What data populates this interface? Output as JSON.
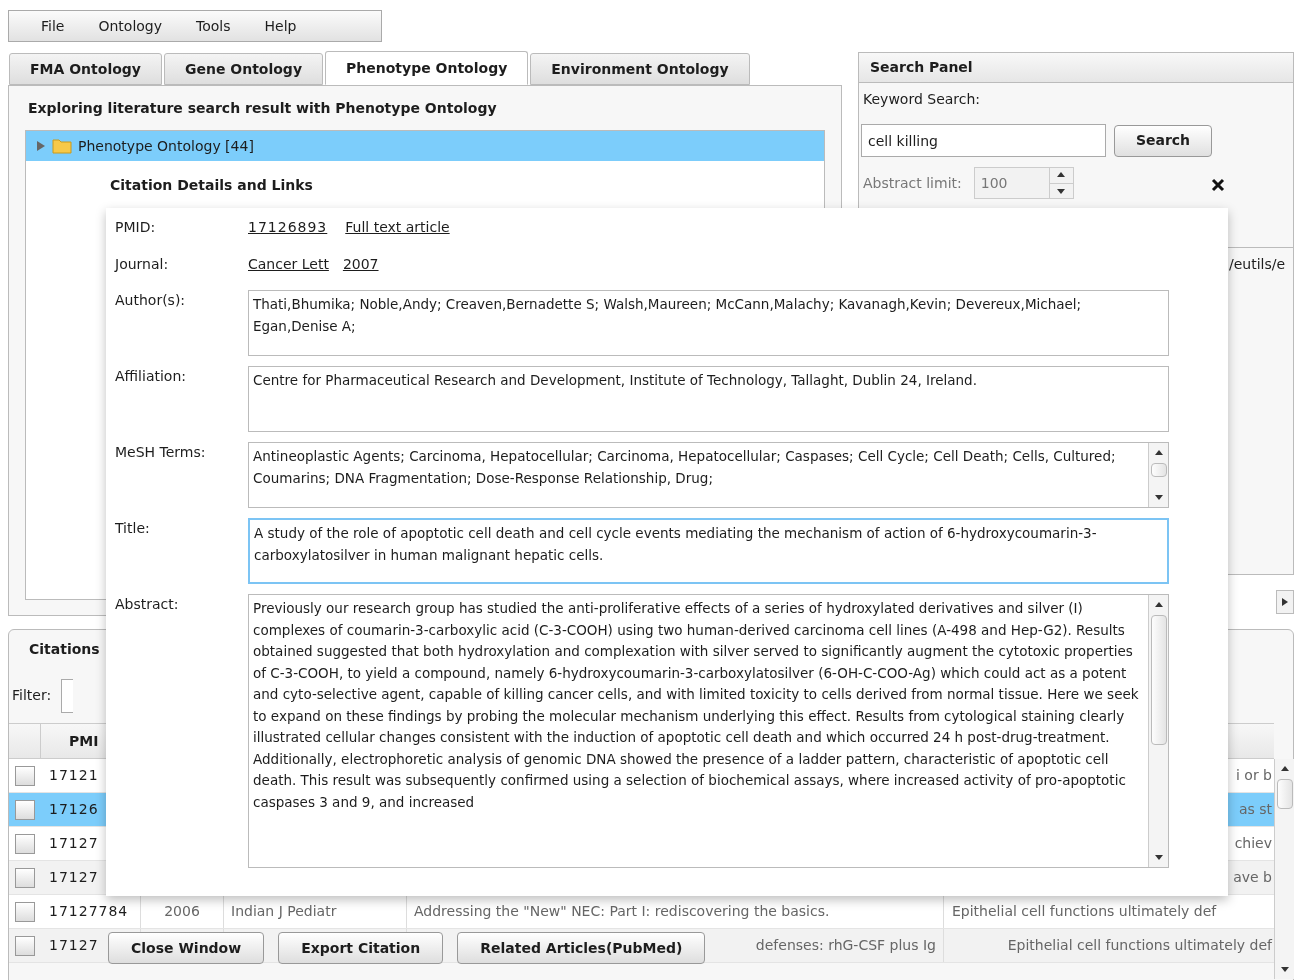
{
  "menu": [
    "File",
    "Ontology",
    "Tools",
    "Help"
  ],
  "tabs": [
    {
      "label": "FMA Ontology",
      "selected": false
    },
    {
      "label": "Gene Ontology",
      "selected": false
    },
    {
      "label": "Phenotype Ontology",
      "selected": true
    },
    {
      "label": "Environment Ontology",
      "selected": false
    }
  ],
  "ontology_panel": {
    "title": "Exploring literature search result with Phenotype Ontology",
    "tree": [
      {
        "label": "Phenotype Ontology [44]",
        "expanded": false,
        "selected": true
      }
    ]
  },
  "search_panel": {
    "title": "Search Panel",
    "keyword_label": "Keyword Search:",
    "keyword_value": "cell killing",
    "search_button": "Search",
    "abstract_limit_label": "Abstract limit:",
    "abstract_limit_value": "100",
    "url_fragment": "/eutils/e"
  },
  "citations": {
    "title": "Citations",
    "filter_label": "Filter:",
    "columns": [
      "PMI"
    ],
    "rows": [
      {
        "kind": "partial",
        "checked": false,
        "selected": false,
        "pmid": "17121",
        "abstract": "i or b"
      },
      {
        "kind": "partial",
        "checked": false,
        "selected": true,
        "pmid": "17126",
        "abstract": "as st"
      },
      {
        "kind": "partial",
        "checked": false,
        "selected": false,
        "pmid": "17127",
        "abstract": "chiev"
      },
      {
        "kind": "partial",
        "checked": false,
        "selected": false,
        "pmid": "17127",
        "abstract": "ave b"
      },
      {
        "kind": "full",
        "checked": false,
        "selected": false,
        "pmid": "17127784",
        "year": "2006",
        "journal": "Indian J Pediatr",
        "title": "Addressing the \"New\" NEC: Part I: rediscovering the basics.",
        "abstract": "Epithelial cell functions ultimately def"
      },
      {
        "kind": "partial",
        "checked": false,
        "selected": false,
        "pmid": "17127",
        "title": "defenses: rhG-CSF plus Ig",
        "abstract": "Epithelial cell functions ultimately def"
      }
    ]
  },
  "dialog": {
    "title": "Citation Details and Links",
    "pmid_label": "PMID:",
    "pmid": "17126893",
    "full_text_link": "Full text article",
    "journal_label": "Journal:",
    "journal": "Cancer Lett",
    "year": "2007",
    "fields": [
      {
        "kind": "box",
        "label": "Author(s):",
        "value": "Thati,Bhumika; Noble,Andy; Creaven,Bernadette S; Walsh,Maureen; McCann,Malachy; Kavanagh,Kevin; Devereux,Michael; Egan,Denise A;",
        "focused": false
      },
      {
        "kind": "box",
        "label": "Affiliation:",
        "value": "Centre for Pharmaceutical Research and Development, Institute of Technology, Tallaght, Dublin 24, Ireland.",
        "focused": false
      },
      {
        "kind": "scroll",
        "label": "MeSH Terms:",
        "value": "Antineoplastic Agents; Carcinoma, Hepatocellular; Carcinoma, Hepatocellular; Caspases; Cell Cycle; Cell Death; Cells, Cultured; Coumarins; DNA Fragmentation; Dose-Response Relationship, Drug;",
        "focused": false
      },
      {
        "kind": "box",
        "label": "Title:",
        "value": "A study of the role of apoptotic cell death and cell cycle events mediating the mechanism of action of 6-hydroxycoumarin-3-carboxylatosilver in human malignant hepatic cells.",
        "focused": true
      },
      {
        "kind": "long-scroll",
        "label": "Abstract:",
        "value": "Previously our research group has studied the anti-proliferative effects of a series of hydroxylated derivatives and silver (I) complexes of coumarin-3-carboxylic acid (C-3-COOH) using two human-derived carcinoma cell lines (A-498 and Hep-G2). Results obtained suggested that both hydroxylation and complexation with silver served to significantly augment the cytotoxic properties of C-3-COOH, to yield a compound, namely 6-hydroxycoumarin-3-carboxylatosilver (6-OH-C-COO-Ag) which could act as a potent and cyto-selective agent, capable of killing cancer cells, and with limited toxicity to cells derived from normal tissue. Here we seek to expand on these findings by probing the molecular mechanism underlying this effect. Results from cytological staining clearly illustrated cellular changes consistent with the induction of apoptotic cell death and which occurred 24 h post-drug-treatment. Additionally, electrophoretic analysis of genomic DNA showed the presence of a ladder pattern, characteristic of apoptotic cell death. This result was subsequently confirmed using a selection of biochemical assays, where increased activity of pro-apoptotic caspases 3 and 9, and increased",
        "focused": false
      }
    ],
    "buttons": [
      "Close Window",
      "Export Citation",
      "Related Articles(PubMed)"
    ]
  }
}
